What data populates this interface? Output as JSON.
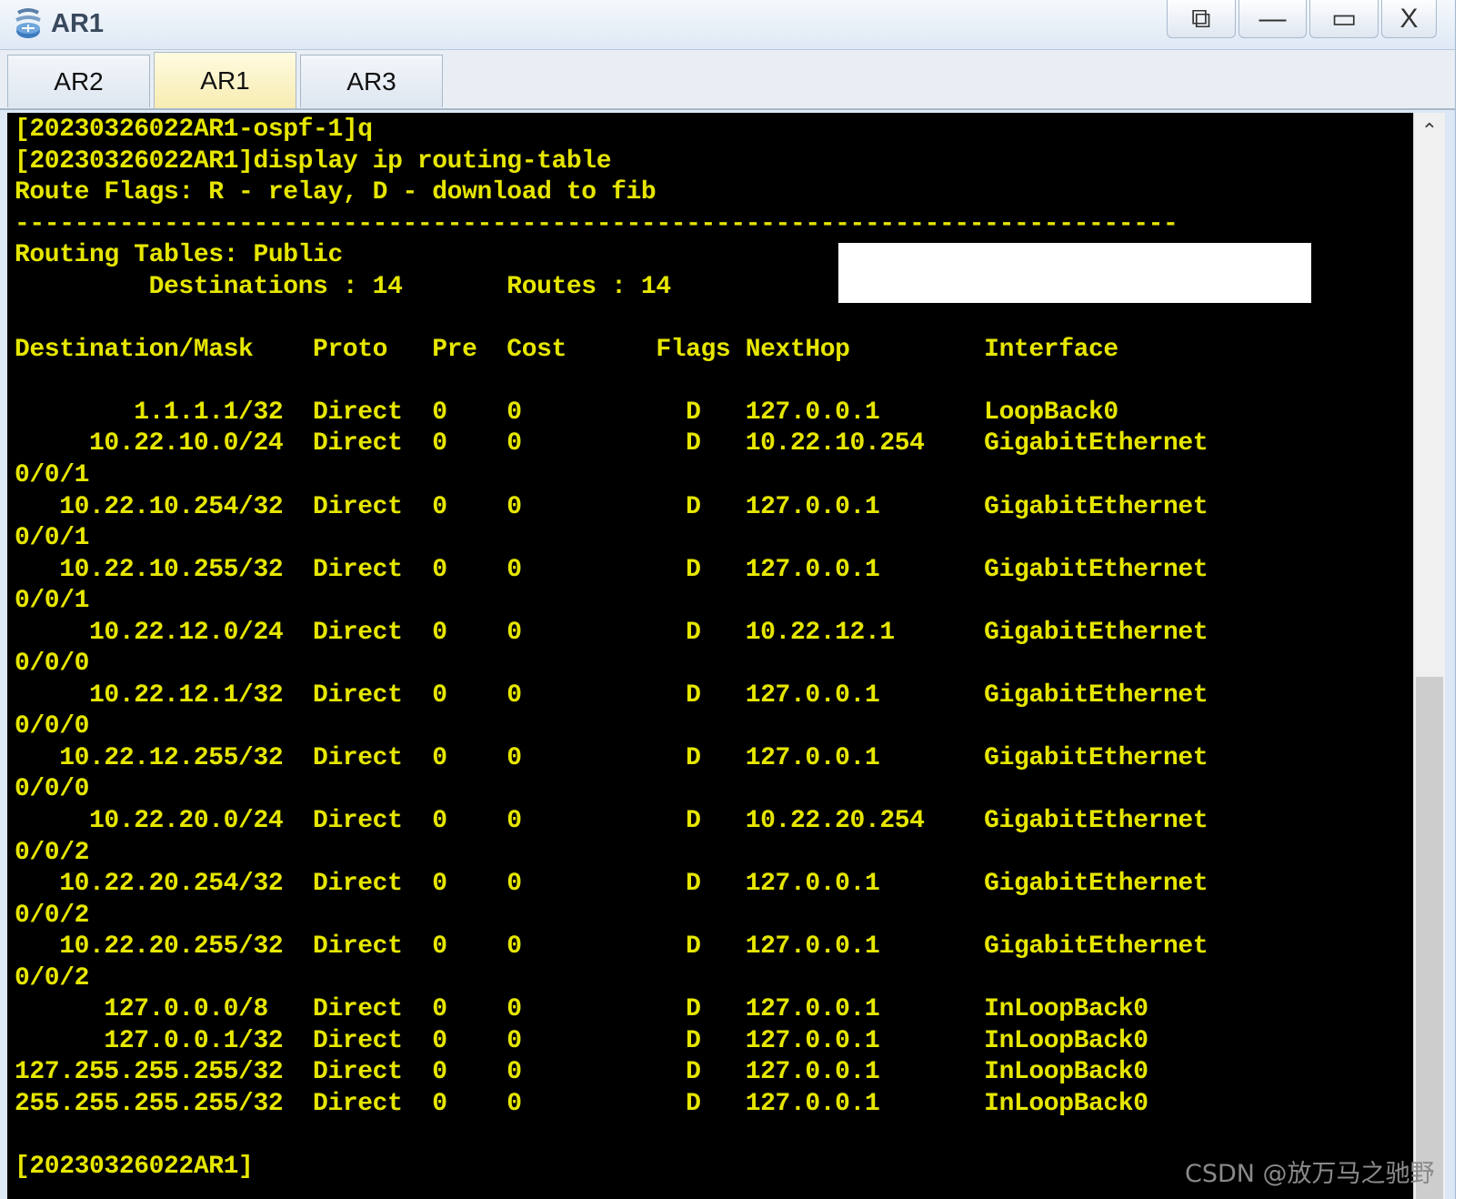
{
  "window": {
    "title": "AR1",
    "controls": {
      "restore": "⧉",
      "minimize": "—",
      "maximize": "▭",
      "close": "X"
    }
  },
  "tabs": [
    {
      "label": "AR2",
      "active": false
    },
    {
      "label": "AR1",
      "active": true
    },
    {
      "label": "AR3",
      "active": false
    }
  ],
  "terminal": {
    "text_color": "#e6e600",
    "background": "#000000",
    "lines": [
      "[20230326022AR1-ospf-1]q",
      "[20230326022AR1]display ip routing-table",
      "Route Flags: R - relay, D - download to fib",
      "------------------------------------------------------------------------------",
      "Routing Tables: Public",
      "         Destinations : 14       Routes : 14",
      "",
      "Destination/Mask    Proto   Pre  Cost      Flags NextHop         Interface",
      "",
      "        1.1.1.1/32  Direct  0    0           D   127.0.0.1       LoopBack0",
      "     10.22.10.0/24  Direct  0    0           D   10.22.10.254    GigabitEthernet",
      "0/0/1",
      "   10.22.10.254/32  Direct  0    0           D   127.0.0.1       GigabitEthernet",
      "0/0/1",
      "   10.22.10.255/32  Direct  0    0           D   127.0.0.1       GigabitEthernet",
      "0/0/1",
      "     10.22.12.0/24  Direct  0    0           D   10.22.12.1      GigabitEthernet",
      "0/0/0",
      "     10.22.12.1/32  Direct  0    0           D   127.0.0.1       GigabitEthernet",
      "0/0/0",
      "   10.22.12.255/32  Direct  0    0           D   127.0.0.1       GigabitEthernet",
      "0/0/0",
      "     10.22.20.0/24  Direct  0    0           D   10.22.20.254    GigabitEthernet",
      "0/0/2",
      "   10.22.20.254/32  Direct  0    0           D   127.0.0.1       GigabitEthernet",
      "0/0/2",
      "   10.22.20.255/32  Direct  0    0           D   127.0.0.1       GigabitEthernet",
      "0/0/2",
      "      127.0.0.0/8   Direct  0    0           D   127.0.0.1       InLoopBack0",
      "      127.0.0.1/32  Direct  0    0           D   127.0.0.1       InLoopBack0",
      "127.255.255.255/32  Direct  0    0           D   127.0.0.1       InLoopBack0",
      "255.255.255.255/32  Direct  0    0           D   127.0.0.1       InLoopBack0",
      "",
      "[20230326022AR1]"
    ]
  },
  "scrollbar": {
    "up_arrow": "⌃"
  },
  "watermark": "CSDN @放万马之驰野"
}
